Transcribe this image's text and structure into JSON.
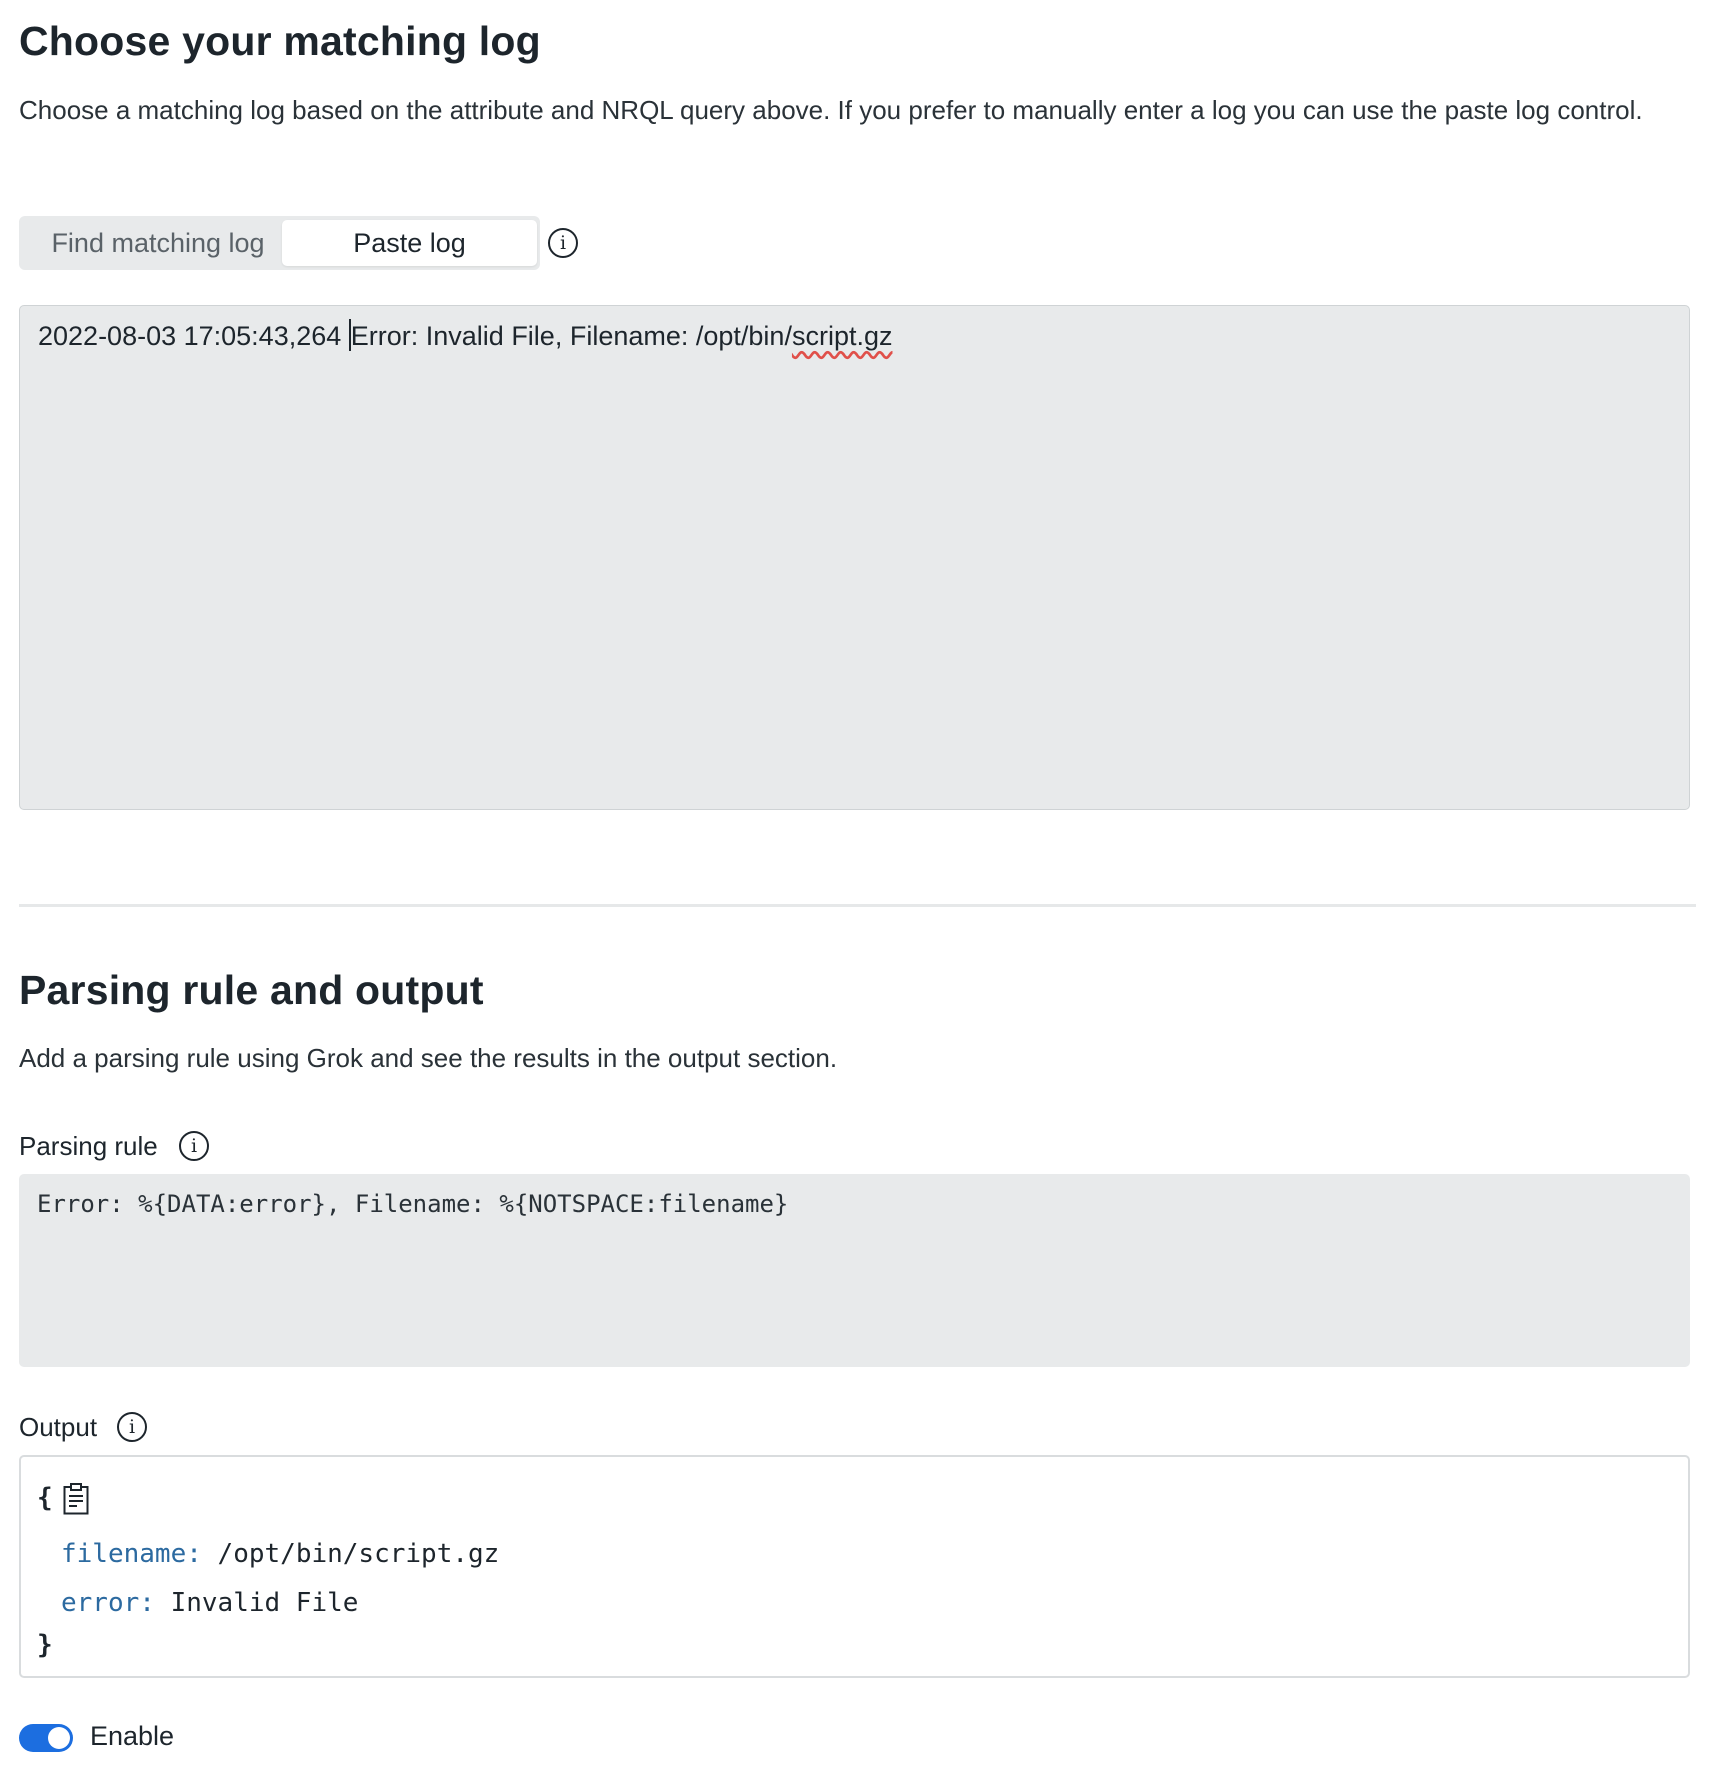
{
  "section_matching": {
    "title": "Choose your matching log",
    "description": "Choose a matching log based on the attribute and NRQL query above. If you prefer to manually enter a log you can use the paste log control.",
    "tabs": [
      {
        "label": "Find matching log",
        "selected": false
      },
      {
        "label": "Paste log",
        "selected": true
      }
    ],
    "info_icon": "info-icon",
    "log": {
      "prefix": "2022-08-03 17:05:43,264 ",
      "middle": "Error: Invalid File, Filename: /opt/bin/",
      "misspelled": "script.gz"
    }
  },
  "section_parsing": {
    "title": "Parsing rule and output",
    "description": "Add a parsing rule using Grok and see the results in the output section.",
    "rule_label": "Parsing rule",
    "rule_value": "Error: %{DATA:error}, Filename: %{NOTSPACE:filename}",
    "output_label": "Output",
    "output": {
      "open_brace": "{",
      "close_brace": "}",
      "copy_icon": "clipboard-icon",
      "fields": [
        {
          "key": "filename:",
          "value": "/opt/bin/script.gz"
        },
        {
          "key": "error:",
          "value": "Invalid File"
        }
      ]
    },
    "enable_label": "Enable",
    "enable_on": true
  },
  "colors": {
    "accent": "#1c6ee0",
    "key": "#2c6aa0",
    "field_bg": "#e8eaeb"
  }
}
